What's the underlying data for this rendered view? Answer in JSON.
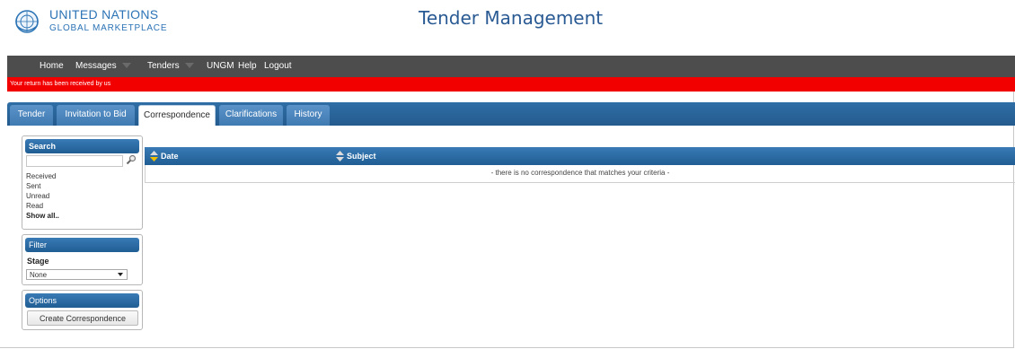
{
  "logo": {
    "line1": "UNITED NATIONS",
    "line2": "GLOBAL MARKETPLACE"
  },
  "app_title": "Tender Management",
  "topnav": {
    "items": [
      {
        "label": "Home",
        "has_dropdown": false
      },
      {
        "label": "Messages",
        "has_dropdown": true
      },
      {
        "label": "Tenders",
        "has_dropdown": true
      },
      {
        "label": "UNGM",
        "has_dropdown": false
      },
      {
        "label": "Help",
        "has_dropdown": false
      },
      {
        "label": "Logout",
        "has_dropdown": false
      }
    ]
  },
  "alert": {
    "text": "Your return has been received by us",
    "color": "#f20000"
  },
  "tabs": [
    {
      "label": "Tender",
      "active": false
    },
    {
      "label": "Invitation to Bid",
      "active": false
    },
    {
      "label": "Correspondence",
      "active": true
    },
    {
      "label": "Clarifications",
      "active": false
    },
    {
      "label": "History",
      "active": false
    }
  ],
  "search_panel": {
    "title": "Search",
    "input_value": "",
    "links": [
      "Received",
      "Sent",
      "Unread",
      "Read",
      "Show all.."
    ]
  },
  "filter_panel": {
    "title": "Filter",
    "stage_label": "Stage",
    "stage_selected": "None"
  },
  "options_panel": {
    "title": "Options",
    "create_button": "Create Correspondence"
  },
  "grid": {
    "columns": [
      "Date",
      "Subject"
    ],
    "empty_message": "- there is no correspondence that matches your criteria -"
  },
  "colors": {
    "accent_blue": "#2b6ca6",
    "nav_dark": "#4d4d4d",
    "alert_red": "#f20000"
  }
}
